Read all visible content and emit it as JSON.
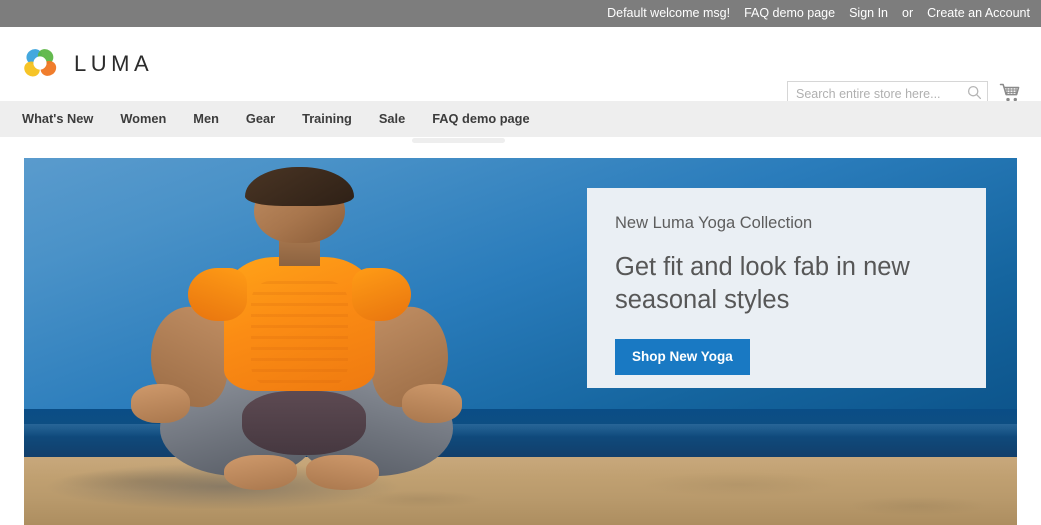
{
  "topbar": {
    "welcome_message": "Default welcome msg!",
    "faq_link": "FAQ demo page",
    "sign_in": "Sign In",
    "or": "or",
    "create_account": "Create an Account"
  },
  "header": {
    "logo_text": "LUMA",
    "logo_icon": "luma-flower-logo",
    "search": {
      "placeholder": "Search entire store here...",
      "value": "",
      "icon": "search-icon"
    },
    "cart_icon": "shopping-cart-icon"
  },
  "nav": {
    "items": [
      {
        "label": "What's New"
      },
      {
        "label": "Women"
      },
      {
        "label": "Men"
      },
      {
        "label": "Gear"
      },
      {
        "label": "Training"
      },
      {
        "label": "Sale"
      },
      {
        "label": "FAQ demo page"
      }
    ]
  },
  "hero": {
    "image_alt": "Woman meditating in lotus pose on a beach",
    "panel": {
      "eyebrow": "New Luma Yoga Collection",
      "headline": "Get fit and look fab in new seasonal styles",
      "cta_label": "Shop New Yoga"
    }
  },
  "annotations": {
    "highlight_top_label": "red-underline-faq-topbar",
    "highlight_nav_label": "red-underline-faq-nav"
  },
  "colors": {
    "topbar_bg": "#7d7d7d",
    "nav_bg": "#eeeeee",
    "accent_red": "#d91e22",
    "cta_blue": "#1979c3",
    "panel_bg": "#eaeff4",
    "text_dark": "#3c3c3c"
  }
}
